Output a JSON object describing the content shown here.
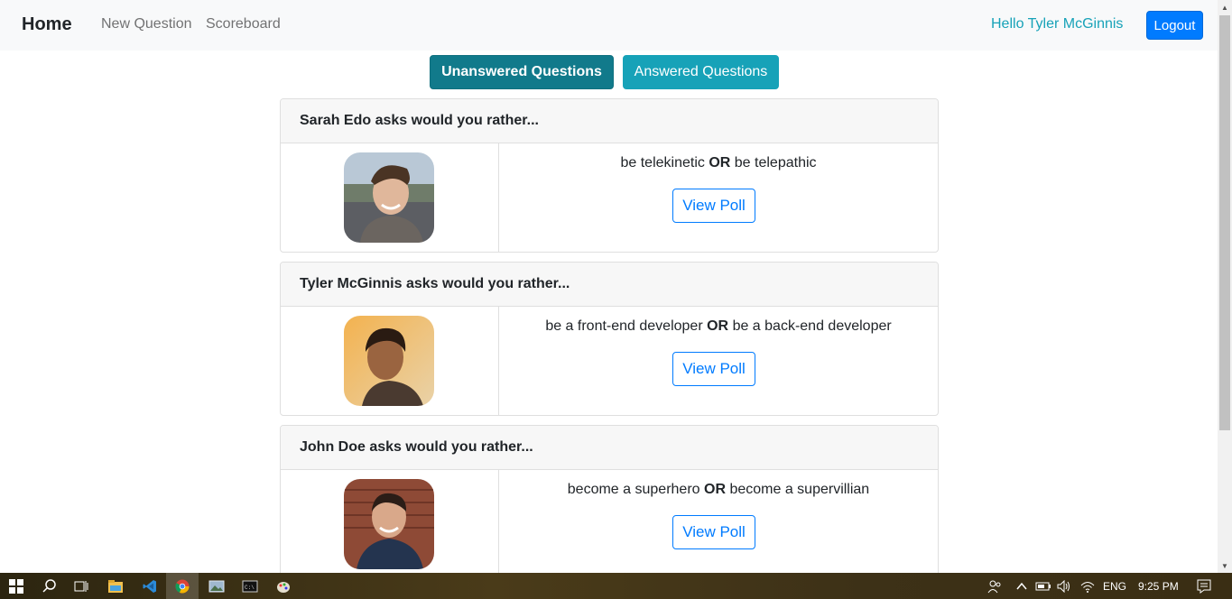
{
  "navbar": {
    "brand": "Home",
    "links": [
      "New Question",
      "Scoreboard"
    ],
    "greeting": "Hello Tyler McGinnis",
    "logout_label": "Logout"
  },
  "tabs": {
    "unanswered": "Unanswered Questions",
    "answered": "Answered Questions",
    "active": "unanswered"
  },
  "questions": [
    {
      "header": "Sarah Edo asks would you rather...",
      "option_one": "be telekinetic",
      "or": "OR",
      "option_two": "be telepathic",
      "button": "View Poll"
    },
    {
      "header": "Tyler McGinnis asks would you rather...",
      "option_one": "be a front-end developer",
      "or": "OR",
      "option_two": "be a back-end developer",
      "button": "View Poll"
    },
    {
      "header": "John Doe asks would you rather...",
      "option_one": "become a superhero",
      "or": "OR",
      "option_two": "become a supervillian",
      "button": "View Poll"
    }
  ],
  "taskbar": {
    "language": "ENG",
    "time": "9:25 PM"
  },
  "colors": {
    "primary": "#007bff",
    "info": "#17a2b8",
    "info_active": "#117a8b"
  }
}
